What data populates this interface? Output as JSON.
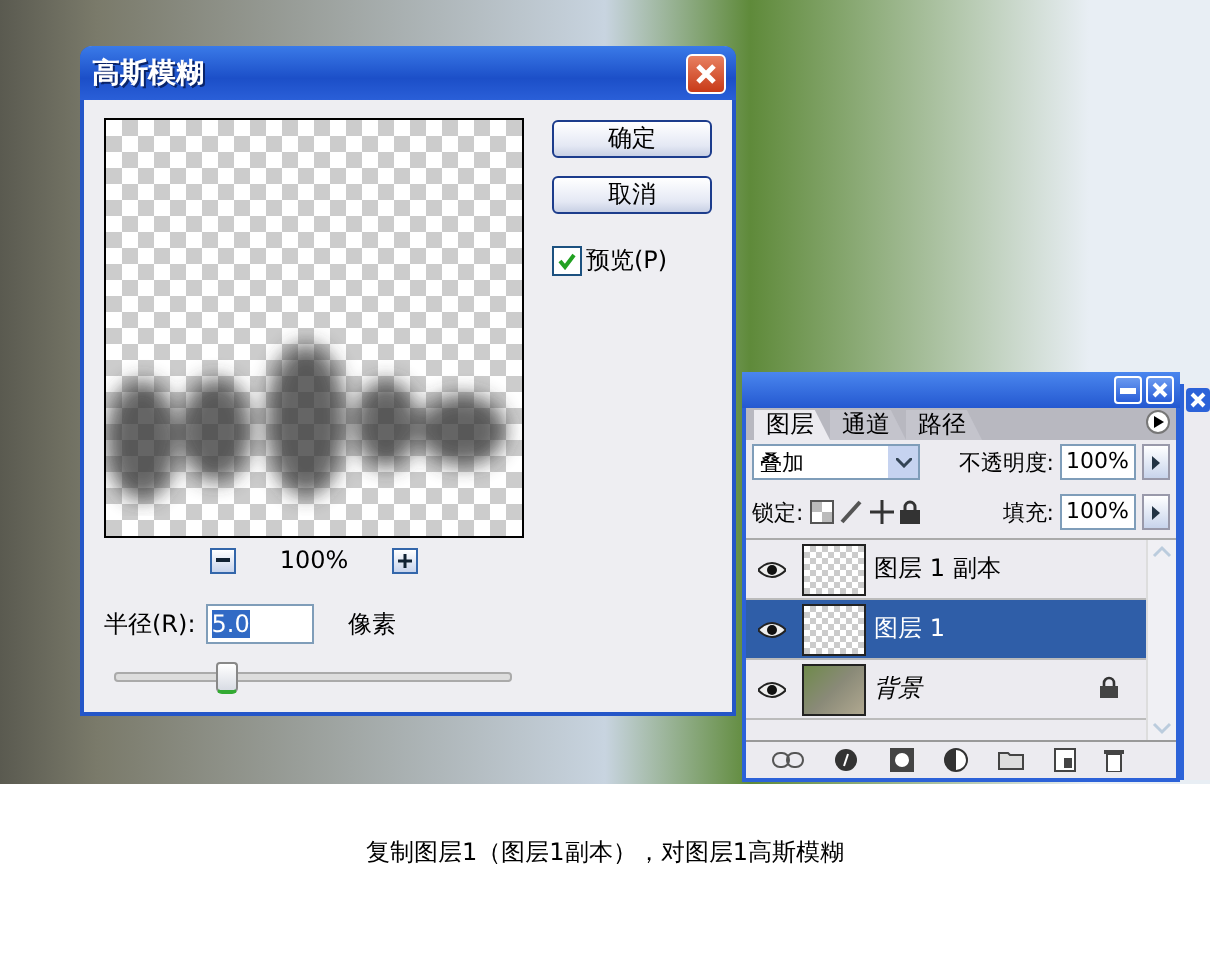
{
  "dialog": {
    "title": "高斯模糊",
    "buttons": [
      {
        "label": "确定"
      },
      {
        "label": "取消"
      }
    ],
    "preview": {
      "label": "预览(P)",
      "checked": true
    },
    "zoom": {
      "value": "100%"
    },
    "radius": {
      "label": "半径(R):",
      "value": "5.0",
      "unit": "像素",
      "level": 0.28
    }
  },
  "layers_panel": {
    "tabs": [
      {
        "label": "图层",
        "selected": true
      },
      {
        "label": "通道",
        "selected": false
      },
      {
        "label": "路径",
        "selected": false
      }
    ],
    "blend_mode": "叠加",
    "opacity_label": "不透明度:",
    "opacity": "100%",
    "lock_label": "锁定:",
    "fill_label": "填充:",
    "fill": "100%",
    "layers": [
      {
        "name": "图层 1 副本",
        "kind": "layer",
        "selected": false,
        "visible": true,
        "locked": false
      },
      {
        "name": "图层 1",
        "kind": "layer",
        "selected": true,
        "visible": true,
        "locked": false
      },
      {
        "name": "背景",
        "kind": "background",
        "selected": false,
        "visible": true,
        "locked": true
      }
    ]
  },
  "caption": "复制图层1（图层1副本），对图层1高斯模糊"
}
